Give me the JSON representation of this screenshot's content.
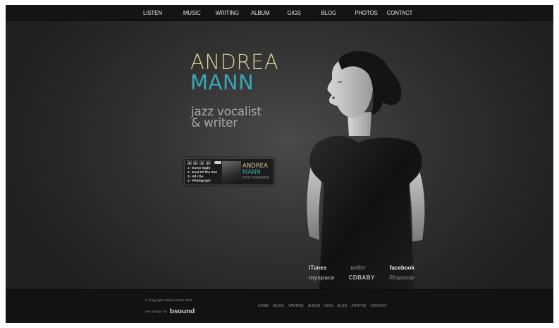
{
  "nav": {
    "items": [
      "LISTEN",
      "MUSIC",
      "WRITING",
      "ALBUM",
      "GIGS",
      "BLOG",
      "PHOTOS",
      "CONTACT"
    ]
  },
  "hero": {
    "first_name": "ANDREA",
    "last_name": "MANN",
    "tagline_line1": "jazz vocalist",
    "tagline_line2": "& writer"
  },
  "player": {
    "tracks": [
      "1 - Every Night",
      "2 - East Of The Sun",
      "3 - All I Do",
      "4 - Photograph"
    ],
    "album_title_1": "ANDREA",
    "album_title_2": "MANN",
    "album_title_3": "PHOTOGRAPH"
  },
  "links": {
    "itunes": "iTunes",
    "twitter": "twitter",
    "facebook": "facebook",
    "myspace": "myspace",
    "cdbaby": "CDBABY",
    "rhapsody": "Rhapsody"
  },
  "footer": {
    "copyright": "© Copyright Andrea Mann 2011",
    "credit_prefix": "web design by",
    "credit_logo": "bsound",
    "links": [
      "HOME",
      "MUSIC",
      "WRITING",
      "ALBUM",
      "GIGS",
      "BLOG",
      "PHOTOS",
      "CONTACT"
    ]
  },
  "colors": {
    "first_name": "#d8cf95",
    "last_name": "#3aa7b4",
    "background": "#2a2a2a",
    "nav_bar": "#141414"
  }
}
